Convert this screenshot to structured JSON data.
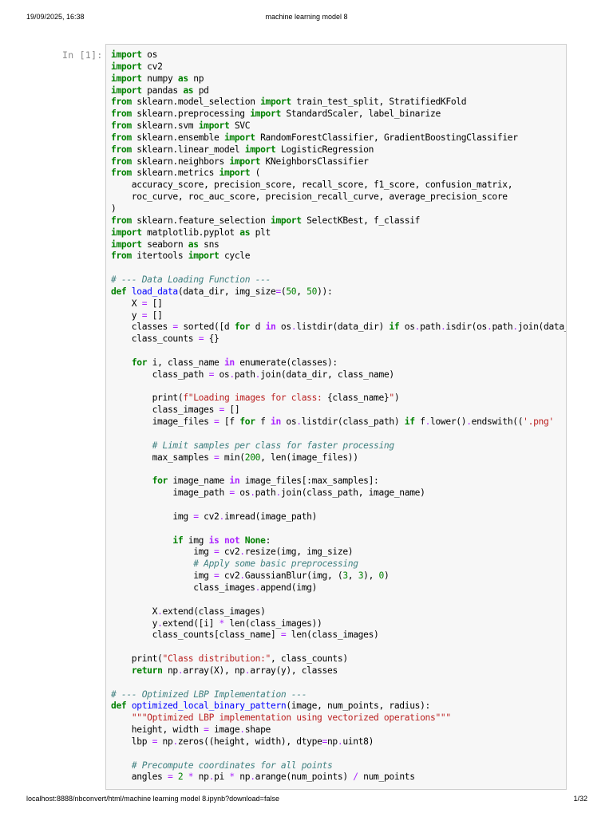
{
  "header": {
    "datetime": "19/09/2025, 16:38",
    "title": "machine learning model 8"
  },
  "cell": {
    "prompt": "In [1]:",
    "lines": [
      [
        [
          "import",
          "kw"
        ],
        [
          " os",
          ""
        ]
      ],
      [
        [
          "import",
          "kw"
        ],
        [
          " cv2",
          ""
        ]
      ],
      [
        [
          "import",
          "kw"
        ],
        [
          " numpy ",
          ""
        ],
        [
          "as",
          "kw"
        ],
        [
          " np",
          ""
        ]
      ],
      [
        [
          "import",
          "kw"
        ],
        [
          " pandas ",
          ""
        ],
        [
          "as",
          "kw"
        ],
        [
          " pd",
          ""
        ]
      ],
      [
        [
          "from",
          "kw"
        ],
        [
          " sklearn.model_selection ",
          ""
        ],
        [
          "import",
          "kw"
        ],
        [
          " train_test_split, StratifiedKFold",
          ""
        ]
      ],
      [
        [
          "from",
          "kw"
        ],
        [
          " sklearn.preprocessing ",
          ""
        ],
        [
          "import",
          "kw"
        ],
        [
          " StandardScaler, label_binarize",
          ""
        ]
      ],
      [
        [
          "from",
          "kw"
        ],
        [
          " sklearn.svm ",
          ""
        ],
        [
          "import",
          "kw"
        ],
        [
          " SVC",
          ""
        ]
      ],
      [
        [
          "from",
          "kw"
        ],
        [
          " sklearn.ensemble ",
          ""
        ],
        [
          "import",
          "kw"
        ],
        [
          " RandomForestClassifier, GradientBoostingClassifier",
          ""
        ]
      ],
      [
        [
          "from",
          "kw"
        ],
        [
          " sklearn.linear_model ",
          ""
        ],
        [
          "import",
          "kw"
        ],
        [
          " LogisticRegression",
          ""
        ]
      ],
      [
        [
          "from",
          "kw"
        ],
        [
          " sklearn.neighbors ",
          ""
        ],
        [
          "import",
          "kw"
        ],
        [
          " KNeighborsClassifier",
          ""
        ]
      ],
      [
        [
          "from",
          "kw"
        ],
        [
          " sklearn.metrics ",
          ""
        ],
        [
          "import",
          "kw"
        ],
        [
          " (",
          ""
        ]
      ],
      [
        [
          "    accuracy_score, precision_score, recall_score, f1_score, confusion_matrix,",
          ""
        ]
      ],
      [
        [
          "    roc_curve, roc_auc_score, precision_recall_curve, average_precision_score",
          ""
        ]
      ],
      [
        [
          ")",
          ""
        ]
      ],
      [
        [
          "from",
          "kw"
        ],
        [
          " sklearn.feature_selection ",
          ""
        ],
        [
          "import",
          "kw"
        ],
        [
          " SelectKBest, f_classif",
          ""
        ]
      ],
      [
        [
          "import",
          "kw"
        ],
        [
          " matplotlib.pyplot ",
          ""
        ],
        [
          "as",
          "kw"
        ],
        [
          " plt",
          ""
        ]
      ],
      [
        [
          "import",
          "kw"
        ],
        [
          " seaborn ",
          ""
        ],
        [
          "as",
          "kw"
        ],
        [
          " sns",
          ""
        ]
      ],
      [
        [
          "from",
          "kw"
        ],
        [
          " itertools ",
          ""
        ],
        [
          "import",
          "kw"
        ],
        [
          " cycle",
          ""
        ]
      ],
      [],
      [
        [
          "# --- Data Loading Function ---",
          "cm"
        ]
      ],
      [
        [
          "def",
          "kw"
        ],
        [
          " ",
          ""
        ],
        [
          "load_data",
          "fn"
        ],
        [
          "(data_dir, img_size",
          ""
        ],
        [
          "=",
          "op"
        ],
        [
          "(",
          ""
        ],
        [
          "50",
          "num"
        ],
        [
          ", ",
          ""
        ],
        [
          "50",
          "num"
        ],
        [
          ")):",
          ""
        ]
      ],
      [
        [
          "    X ",
          ""
        ],
        [
          "=",
          "op"
        ],
        [
          " []",
          ""
        ]
      ],
      [
        [
          "    y ",
          ""
        ],
        [
          "=",
          "op"
        ],
        [
          " []",
          ""
        ]
      ],
      [
        [
          "    classes ",
          ""
        ],
        [
          "=",
          "op"
        ],
        [
          " sorted([d ",
          ""
        ],
        [
          "for",
          "kw"
        ],
        [
          " d ",
          ""
        ],
        [
          "in",
          "opb"
        ],
        [
          " os",
          ""
        ],
        [
          ".",
          "op"
        ],
        [
          "listdir(data_dir) ",
          ""
        ],
        [
          "if",
          "kw"
        ],
        [
          " os",
          ""
        ],
        [
          ".",
          "op"
        ],
        [
          "path",
          ""
        ],
        [
          ".",
          "op"
        ],
        [
          "isdir(os",
          ""
        ],
        [
          ".",
          "op"
        ],
        [
          "path",
          ""
        ],
        [
          ".",
          "op"
        ],
        [
          "join(data_dir, d))])",
          ""
        ]
      ],
      [
        [
          "    class_counts ",
          ""
        ],
        [
          "=",
          "op"
        ],
        [
          " {}",
          ""
        ]
      ],
      [],
      [
        [
          "    ",
          ""
        ],
        [
          "for",
          "kw"
        ],
        [
          " i, class_name ",
          ""
        ],
        [
          "in",
          "opb"
        ],
        [
          " enumerate(classes):",
          ""
        ]
      ],
      [
        [
          "        class_path ",
          ""
        ],
        [
          "=",
          "op"
        ],
        [
          " os",
          ""
        ],
        [
          ".",
          "op"
        ],
        [
          "path",
          ""
        ],
        [
          ".",
          "op"
        ],
        [
          "join(data_dir, class_name)",
          ""
        ]
      ],
      [],
      [
        [
          "        print(",
          ""
        ],
        [
          "f\"Loading images for class: ",
          "str"
        ],
        [
          "{class_name}",
          ""
        ],
        [
          "\"",
          "str"
        ],
        [
          ")",
          ""
        ]
      ],
      [
        [
          "        class_images ",
          ""
        ],
        [
          "=",
          "op"
        ],
        [
          " []",
          ""
        ]
      ],
      [
        [
          "        image_files ",
          ""
        ],
        [
          "=",
          "op"
        ],
        [
          " [f ",
          ""
        ],
        [
          "for",
          "kw"
        ],
        [
          " f ",
          ""
        ],
        [
          "in",
          "opb"
        ],
        [
          " os",
          ""
        ],
        [
          ".",
          "op"
        ],
        [
          "listdir(class_path) ",
          ""
        ],
        [
          "if",
          "kw"
        ],
        [
          " f",
          ""
        ],
        [
          ".",
          "op"
        ],
        [
          "lower()",
          ""
        ],
        [
          ".",
          "op"
        ],
        [
          "endswith((",
          ""
        ],
        [
          "'.png'",
          "str"
        ]
      ],
      [],
      [
        [
          "        ",
          ""
        ],
        [
          "# Limit samples per class for faster processing",
          "cm"
        ]
      ],
      [
        [
          "        max_samples ",
          ""
        ],
        [
          "=",
          "op"
        ],
        [
          " min(",
          ""
        ],
        [
          "200",
          "num"
        ],
        [
          ", len(image_files))",
          ""
        ]
      ],
      [],
      [
        [
          "        ",
          ""
        ],
        [
          "for",
          "kw"
        ],
        [
          " image_name ",
          ""
        ],
        [
          "in",
          "opb"
        ],
        [
          " image_files[:max_samples]:",
          ""
        ]
      ],
      [
        [
          "            image_path ",
          ""
        ],
        [
          "=",
          "op"
        ],
        [
          " os",
          ""
        ],
        [
          ".",
          "op"
        ],
        [
          "path",
          ""
        ],
        [
          ".",
          "op"
        ],
        [
          "join(class_path, image_name)",
          ""
        ]
      ],
      [],
      [
        [
          "            img ",
          ""
        ],
        [
          "=",
          "op"
        ],
        [
          " cv2",
          ""
        ],
        [
          ".",
          "op"
        ],
        [
          "imread(image_path)",
          ""
        ]
      ],
      [],
      [
        [
          "            ",
          ""
        ],
        [
          "if",
          "kw"
        ],
        [
          " img ",
          ""
        ],
        [
          "is",
          "opb"
        ],
        [
          " ",
          ""
        ],
        [
          "not",
          "opb"
        ],
        [
          " ",
          ""
        ],
        [
          "None",
          "kw"
        ],
        [
          ":",
          ""
        ]
      ],
      [
        [
          "                img ",
          ""
        ],
        [
          "=",
          "op"
        ],
        [
          " cv2",
          ""
        ],
        [
          ".",
          "op"
        ],
        [
          "resize(img, img_size)",
          ""
        ]
      ],
      [
        [
          "                ",
          ""
        ],
        [
          "# Apply some basic preprocessing",
          "cm"
        ]
      ],
      [
        [
          "                img ",
          ""
        ],
        [
          "=",
          "op"
        ],
        [
          " cv2",
          ""
        ],
        [
          ".",
          "op"
        ],
        [
          "GaussianBlur(img, (",
          ""
        ],
        [
          "3",
          "num"
        ],
        [
          ", ",
          ""
        ],
        [
          "3",
          "num"
        ],
        [
          "), ",
          ""
        ],
        [
          "0",
          "num"
        ],
        [
          ")",
          ""
        ]
      ],
      [
        [
          "                class_images",
          ""
        ],
        [
          ".",
          "op"
        ],
        [
          "append(img)",
          ""
        ]
      ],
      [],
      [
        [
          "        X",
          ""
        ],
        [
          ".",
          "op"
        ],
        [
          "extend(class_images)",
          ""
        ]
      ],
      [
        [
          "        y",
          ""
        ],
        [
          ".",
          "op"
        ],
        [
          "extend([i] ",
          ""
        ],
        [
          "*",
          "op"
        ],
        [
          " len(class_images))",
          ""
        ]
      ],
      [
        [
          "        class_counts[class_name] ",
          ""
        ],
        [
          "=",
          "op"
        ],
        [
          " len(class_images)",
          ""
        ]
      ],
      [],
      [
        [
          "    print(",
          ""
        ],
        [
          "\"Class distribution:\"",
          "str"
        ],
        [
          ", class_counts)",
          ""
        ]
      ],
      [
        [
          "    ",
          ""
        ],
        [
          "return",
          "kw"
        ],
        [
          " np",
          ""
        ],
        [
          ".",
          "op"
        ],
        [
          "array(X), np",
          ""
        ],
        [
          ".",
          "op"
        ],
        [
          "array(y), classes",
          ""
        ]
      ],
      [],
      [
        [
          "# --- Optimized LBP Implementation ---",
          "cm"
        ]
      ],
      [
        [
          "def",
          "kw"
        ],
        [
          " ",
          ""
        ],
        [
          "optimized_local_binary_pattern",
          "fn"
        ],
        [
          "(image, num_points, radius):",
          ""
        ]
      ],
      [
        [
          "    ",
          ""
        ],
        [
          "\"\"\"Optimized LBP implementation using vectorized operations\"\"\"",
          "str"
        ]
      ],
      [
        [
          "    height, width ",
          ""
        ],
        [
          "=",
          "op"
        ],
        [
          " image",
          ""
        ],
        [
          ".",
          "op"
        ],
        [
          "shape",
          ""
        ]
      ],
      [
        [
          "    lbp ",
          ""
        ],
        [
          "=",
          "op"
        ],
        [
          " np",
          ""
        ],
        [
          ".",
          "op"
        ],
        [
          "zeros((height, width), dtype",
          ""
        ],
        [
          "=",
          "op"
        ],
        [
          "np",
          ""
        ],
        [
          ".",
          "op"
        ],
        [
          "uint8)",
          ""
        ]
      ],
      [],
      [
        [
          "    ",
          ""
        ],
        [
          "# Precompute coordinates for all points",
          "cm"
        ]
      ],
      [
        [
          "    angles ",
          ""
        ],
        [
          "=",
          "op"
        ],
        [
          " ",
          ""
        ],
        [
          "2",
          "num"
        ],
        [
          " ",
          ""
        ],
        [
          "*",
          "op"
        ],
        [
          " np",
          ""
        ],
        [
          ".",
          "op"
        ],
        [
          "pi ",
          ""
        ],
        [
          "*",
          "op"
        ],
        [
          " np",
          ""
        ],
        [
          ".",
          "op"
        ],
        [
          "arange(num_points) ",
          ""
        ],
        [
          "/",
          "op"
        ],
        [
          " num_points",
          ""
        ]
      ]
    ]
  },
  "footer": {
    "url": "localhost:8888/nbconvert/html/machine learning model 8.ipynb?download=false",
    "page": "1/32"
  },
  "colors": {
    "keyword": "#008000",
    "operator": "#aa22ff",
    "string": "#ba2121",
    "comment": "#408080",
    "function": "#0000ff",
    "cell_background": "#f7f7f7"
  }
}
